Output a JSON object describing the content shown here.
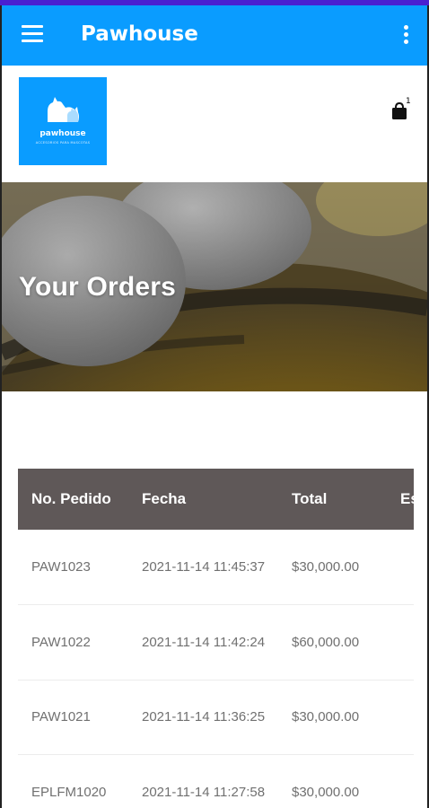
{
  "appbar": {
    "title": "Pawhouse",
    "menu_icon": "hamburger-menu-icon",
    "overflow_icon": "more-vert-icon",
    "color": "#0a9cff"
  },
  "header": {
    "logo_text": "pawhouse",
    "logo_subtext": "ACCESORIOS PARA MASCOTAS",
    "cart_icon": "shopping-bag-icon",
    "cart_count": "1"
  },
  "hero": {
    "title": "Your Orders"
  },
  "orders_table": {
    "headers": [
      "No. Pedido",
      "Fecha",
      "Total",
      "Es"
    ],
    "rows": [
      {
        "id": "PAW1023",
        "date": "2021-11-14 11:45:37",
        "total": "$30,000.00"
      },
      {
        "id": "PAW1022",
        "date": "2021-11-14 11:42:24",
        "total": "$60,000.00"
      },
      {
        "id": "PAW1021",
        "date": "2021-11-14 11:36:25",
        "total": "$30,000.00"
      },
      {
        "id": "EPLFM1020",
        "date": "2021-11-14 11:27:58",
        "total": "$30,000.00"
      }
    ]
  }
}
